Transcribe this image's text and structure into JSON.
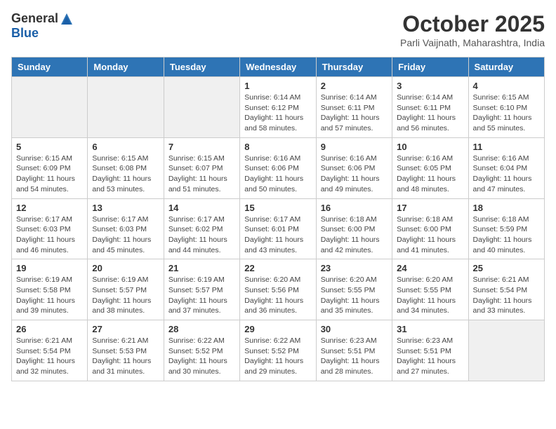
{
  "logo": {
    "general": "General",
    "blue": "Blue"
  },
  "title": "October 2025",
  "location": "Parli Vaijnath, Maharashtra, India",
  "weekdays": [
    "Sunday",
    "Monday",
    "Tuesday",
    "Wednesday",
    "Thursday",
    "Friday",
    "Saturday"
  ],
  "weeks": [
    [
      {
        "day": "",
        "info": ""
      },
      {
        "day": "",
        "info": ""
      },
      {
        "day": "",
        "info": ""
      },
      {
        "day": "1",
        "info": "Sunrise: 6:14 AM\nSunset: 6:12 PM\nDaylight: 11 hours and 58 minutes."
      },
      {
        "day": "2",
        "info": "Sunrise: 6:14 AM\nSunset: 6:11 PM\nDaylight: 11 hours and 57 minutes."
      },
      {
        "day": "3",
        "info": "Sunrise: 6:14 AM\nSunset: 6:11 PM\nDaylight: 11 hours and 56 minutes."
      },
      {
        "day": "4",
        "info": "Sunrise: 6:15 AM\nSunset: 6:10 PM\nDaylight: 11 hours and 55 minutes."
      }
    ],
    [
      {
        "day": "5",
        "info": "Sunrise: 6:15 AM\nSunset: 6:09 PM\nDaylight: 11 hours and 54 minutes."
      },
      {
        "day": "6",
        "info": "Sunrise: 6:15 AM\nSunset: 6:08 PM\nDaylight: 11 hours and 53 minutes."
      },
      {
        "day": "7",
        "info": "Sunrise: 6:15 AM\nSunset: 6:07 PM\nDaylight: 11 hours and 51 minutes."
      },
      {
        "day": "8",
        "info": "Sunrise: 6:16 AM\nSunset: 6:06 PM\nDaylight: 11 hours and 50 minutes."
      },
      {
        "day": "9",
        "info": "Sunrise: 6:16 AM\nSunset: 6:06 PM\nDaylight: 11 hours and 49 minutes."
      },
      {
        "day": "10",
        "info": "Sunrise: 6:16 AM\nSunset: 6:05 PM\nDaylight: 11 hours and 48 minutes."
      },
      {
        "day": "11",
        "info": "Sunrise: 6:16 AM\nSunset: 6:04 PM\nDaylight: 11 hours and 47 minutes."
      }
    ],
    [
      {
        "day": "12",
        "info": "Sunrise: 6:17 AM\nSunset: 6:03 PM\nDaylight: 11 hours and 46 minutes."
      },
      {
        "day": "13",
        "info": "Sunrise: 6:17 AM\nSunset: 6:03 PM\nDaylight: 11 hours and 45 minutes."
      },
      {
        "day": "14",
        "info": "Sunrise: 6:17 AM\nSunset: 6:02 PM\nDaylight: 11 hours and 44 minutes."
      },
      {
        "day": "15",
        "info": "Sunrise: 6:17 AM\nSunset: 6:01 PM\nDaylight: 11 hours and 43 minutes."
      },
      {
        "day": "16",
        "info": "Sunrise: 6:18 AM\nSunset: 6:00 PM\nDaylight: 11 hours and 42 minutes."
      },
      {
        "day": "17",
        "info": "Sunrise: 6:18 AM\nSunset: 6:00 PM\nDaylight: 11 hours and 41 minutes."
      },
      {
        "day": "18",
        "info": "Sunrise: 6:18 AM\nSunset: 5:59 PM\nDaylight: 11 hours and 40 minutes."
      }
    ],
    [
      {
        "day": "19",
        "info": "Sunrise: 6:19 AM\nSunset: 5:58 PM\nDaylight: 11 hours and 39 minutes."
      },
      {
        "day": "20",
        "info": "Sunrise: 6:19 AM\nSunset: 5:57 PM\nDaylight: 11 hours and 38 minutes."
      },
      {
        "day": "21",
        "info": "Sunrise: 6:19 AM\nSunset: 5:57 PM\nDaylight: 11 hours and 37 minutes."
      },
      {
        "day": "22",
        "info": "Sunrise: 6:20 AM\nSunset: 5:56 PM\nDaylight: 11 hours and 36 minutes."
      },
      {
        "day": "23",
        "info": "Sunrise: 6:20 AM\nSunset: 5:55 PM\nDaylight: 11 hours and 35 minutes."
      },
      {
        "day": "24",
        "info": "Sunrise: 6:20 AM\nSunset: 5:55 PM\nDaylight: 11 hours and 34 minutes."
      },
      {
        "day": "25",
        "info": "Sunrise: 6:21 AM\nSunset: 5:54 PM\nDaylight: 11 hours and 33 minutes."
      }
    ],
    [
      {
        "day": "26",
        "info": "Sunrise: 6:21 AM\nSunset: 5:54 PM\nDaylight: 11 hours and 32 minutes."
      },
      {
        "day": "27",
        "info": "Sunrise: 6:21 AM\nSunset: 5:53 PM\nDaylight: 11 hours and 31 minutes."
      },
      {
        "day": "28",
        "info": "Sunrise: 6:22 AM\nSunset: 5:52 PM\nDaylight: 11 hours and 30 minutes."
      },
      {
        "day": "29",
        "info": "Sunrise: 6:22 AM\nSunset: 5:52 PM\nDaylight: 11 hours and 29 minutes."
      },
      {
        "day": "30",
        "info": "Sunrise: 6:23 AM\nSunset: 5:51 PM\nDaylight: 11 hours and 28 minutes."
      },
      {
        "day": "31",
        "info": "Sunrise: 6:23 AM\nSunset: 5:51 PM\nDaylight: 11 hours and 27 minutes."
      },
      {
        "day": "",
        "info": ""
      }
    ]
  ]
}
